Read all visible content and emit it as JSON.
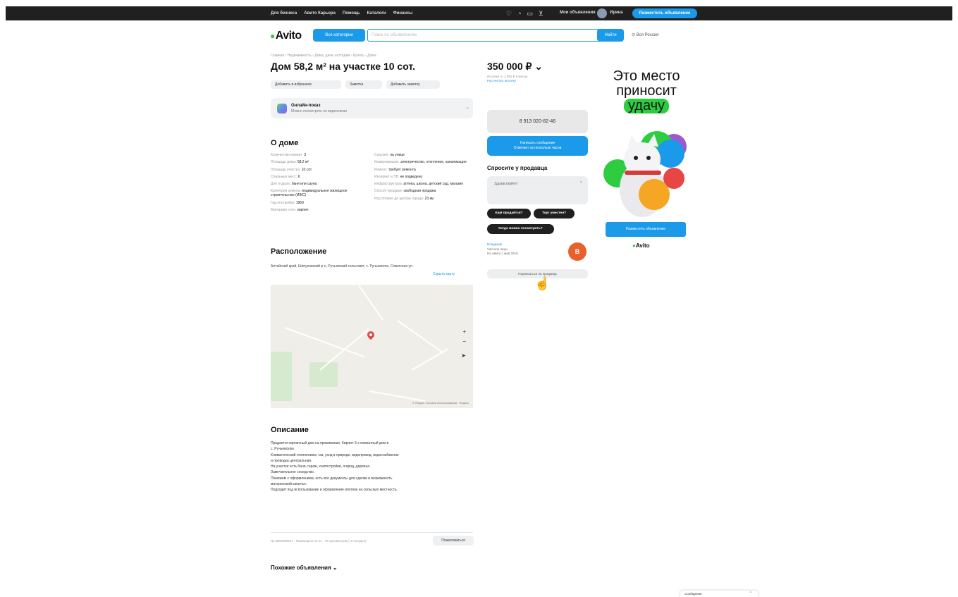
{
  "topbar": {
    "nav": [
      "Для бизнеса",
      "Авито Карьера",
      "Помощь",
      "Каталоги",
      "Финансы"
    ],
    "icons": [
      "heart-icon",
      "bell-icon",
      "chat-icon",
      "cart-icon"
    ],
    "my_ads": "Мои объявления",
    "user": "Ирина",
    "post_button": "Разместить объявление"
  },
  "header": {
    "logo": "Avito",
    "categories_button": "Все категории",
    "search_placeholder": "Поиск по объявлениям",
    "search_button": "Найти",
    "region": "Вся Россия"
  },
  "listing": {
    "breadcrumbs": "Главная › Недвижимость › Дома, дачи, коттеджи › Купить › Дома",
    "title": "Дом 58,2 м² на участке 10 сот.",
    "actions": [
      "Добавить в избранное",
      "Заметка",
      "Добавить заметку"
    ],
    "promo_title": "Онлайн-показ",
    "promo_subtitle": "Можно посмотреть по видеосвязи",
    "about_heading": "О доме",
    "params_left": [
      {
        "k": "Количество комнат:",
        "v": "3"
      },
      {
        "k": "Площадь дома:",
        "v": "58,2 м²"
      },
      {
        "k": "Площадь участка:",
        "v": "10 сот."
      },
      {
        "k": "Спальных мест:",
        "v": "6"
      },
      {
        "k": "Для отдыха:",
        "v": "баня или сауна"
      },
      {
        "k": "Категория земель:",
        "v": "индивидуальное жилищное строительство (ИЖС)"
      },
      {
        "k": "Год постройки:",
        "v": "1969"
      },
      {
        "k": "Материал стен:",
        "v": "кирпич"
      }
    ],
    "params_right": [
      {
        "k": "Санузел:",
        "v": "на улице"
      },
      {
        "k": "Коммуникации:",
        "v": "электричество, отопление, канализация"
      },
      {
        "k": "Ремонт:",
        "v": "требует ремонта"
      },
      {
        "k": "Интернет и ТВ:",
        "v": "не подведено"
      },
      {
        "k": "Инфраструктура:",
        "v": "аптека, школа, детский сад, магазин"
      },
      {
        "k": "Способ продажи:",
        "v": "свободная продажа"
      },
      {
        "k": "Расстояние до центра города:",
        "v": "23 км"
      }
    ],
    "location_heading": "Расположение",
    "address": "Алтайский край, Шипуновский р-н, Ручьевский сельсовет, с. Ручьевское, Советская ул.",
    "show_on_map": "Скрыть карту",
    "map_controls": [
      "+",
      "−",
      "➤"
    ],
    "map_copyright": "© Яндекс Условия использования · Яндекс",
    "description_heading": "Описание",
    "description": [
      "Продается кирпичный дом на проживание. Кирпич 3-х комнатный дом в",
      "с. Ручьевском.",
      "Климатический отоплением, газ, уход в природе, водопровод, водоснабжение",
      "и проводка центральная.",
      "На участке есть баня, гараж, хозпостройки, огород, деревья.",
      "Замечательное соседство.",
      "Поможем с оформлением, есть все документы для сделки и возможность",
      "материнский капитал.",
      "Подходит под использование и оформление ипотеки на сельскую местность."
    ],
    "footer_info": "№ 3551908467 · Размещено 11.11 · 75 просмотров (+3 сегодня)",
    "report_button": "Пожаловаться",
    "similar": "Похожие объявления ⌄"
  },
  "sidebar": {
    "price": "350 000 ₽ ⌄",
    "price_sub1": "Ипотека от 2 850 ₽ в месяц",
    "price_sub2": "Рассчитать ипотеку",
    "phone": "8 913 020-82-46",
    "write_line1": "Написать сообщение",
    "write_line2": "Отвечает за несколько часов",
    "ask_heading": "Спросите у продавца",
    "ask_placeholder": "Здравствуйте!",
    "chips": [
      "Ещё продаётся?",
      "Торг уместен?",
      "Когда можно посмотреть?"
    ],
    "seller_name": "Владимир",
    "seller_type": "Частное лицо",
    "seller_since": "На Авито с мая 2019",
    "seller_initial": "В",
    "subscribe": "Подписаться на продавца"
  },
  "ad": {
    "line1": "Это место",
    "line2": "приносит",
    "highlight": "удачу",
    "button": "Разместить объявление",
    "logo": "Avito"
  },
  "messenger": {
    "label": "Сообщения",
    "caret": "⌃"
  }
}
